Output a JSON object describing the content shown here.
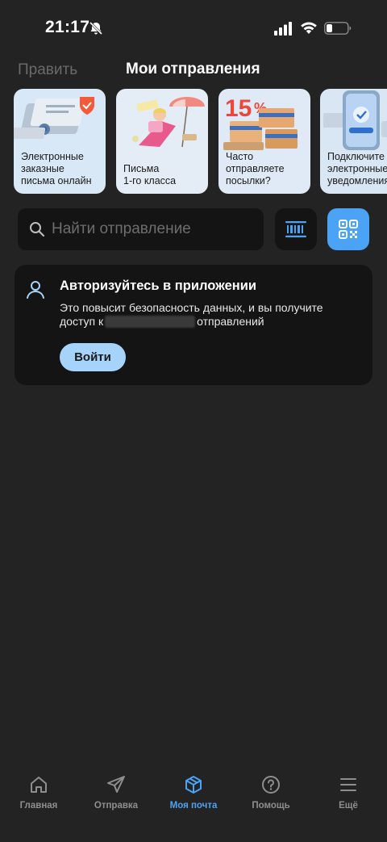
{
  "status_bar": {
    "time": "21:17"
  },
  "header": {
    "edit_label": "Править",
    "title": "Мои отправления"
  },
  "cards": [
    {
      "label": "Электронные\nзаказные\nписьма онлайн"
    },
    {
      "label": "Письма\n1-го класса"
    },
    {
      "label": "Часто\nотправляете\nпосылки?"
    },
    {
      "label": "Подключите\nэлектронные\nуведомления"
    }
  ],
  "search": {
    "placeholder": "Найти отправление"
  },
  "auth": {
    "title": "Авторизуйтесь в приложении",
    "text_line1": "Это повысит безопасность данных, и вы получите",
    "text_line2_before": "доступ к",
    "text_line2_after": "отправлений",
    "button_label": "Войти"
  },
  "nav": {
    "items": [
      {
        "label": "Главная",
        "icon": "home-icon"
      },
      {
        "label": "Отправка",
        "icon": "paper-plane-icon"
      },
      {
        "label": "Моя почта",
        "icon": "parcel-box-icon",
        "active": true
      },
      {
        "label": "Помощь",
        "icon": "question-icon"
      },
      {
        "label": "Ещё",
        "icon": "menu-icon"
      }
    ]
  },
  "colors": {
    "accent": "#4aa3f5",
    "background": "#232323",
    "card": "#141414",
    "button": "#a6d3fa"
  }
}
